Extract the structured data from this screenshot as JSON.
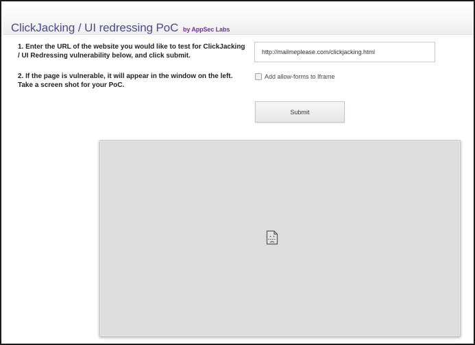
{
  "header": {
    "title": "ClickJacking / UI redressing PoC",
    "byline": "by AppSec Labs"
  },
  "instructions": {
    "step1": "1. Enter the URL of the website you would like to test for ClickJacking / UI Redressing vulnerability below, and click submit.",
    "step2": "2. If the page is vulnerable, it will appear in the window on the left. Take a screen shot for your PoC."
  },
  "form": {
    "url_value": "http://mailmeplease.com/clickjacking.html",
    "checkbox_label": "Add allow-forms to Iframe",
    "checkbox_checked": false,
    "submit_label": "Submit"
  },
  "preview": {
    "icon": "broken-page-icon"
  },
  "colors": {
    "title": "#4b4b8a",
    "byline": "#7a2aa3",
    "iframe_bg": "#dddddd"
  }
}
